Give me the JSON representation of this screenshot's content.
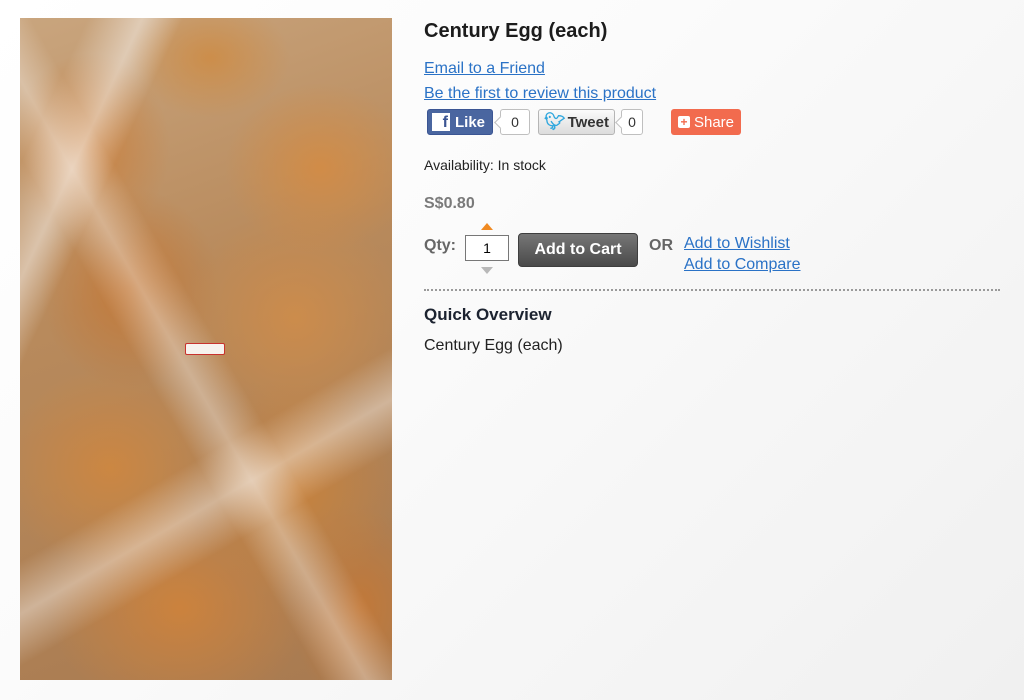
{
  "product": {
    "title": "Century Egg (each)",
    "email_link": "Email to a Friend",
    "review_link": "Be the first to review this product",
    "availability": "Availability: In stock",
    "price": "S$0.80",
    "qty_label": "Qty:",
    "qty_value": "1",
    "add_to_cart": "Add to Cart",
    "or_text": "OR",
    "wishlist_link": "Add to Wishlist",
    "compare_link": "Add to Compare"
  },
  "social": {
    "like_label": "Like",
    "like_count": "0",
    "tweet_label": "Tweet",
    "tweet_count": "0",
    "share_label": "Share"
  },
  "overview": {
    "heading": "Quick Overview",
    "text": "Century Egg (each)"
  },
  "colors": {
    "link": "#2a72c6",
    "facebook": "#4a66a0",
    "share": "#f26b4e",
    "cart_button": "#5a5a5a",
    "qty_arrow_up": "#f08a22"
  },
  "icons": [
    "facebook-icon",
    "twitter-bird-icon",
    "plus-icon",
    "arrow-up-icon",
    "arrow-down-icon"
  ]
}
